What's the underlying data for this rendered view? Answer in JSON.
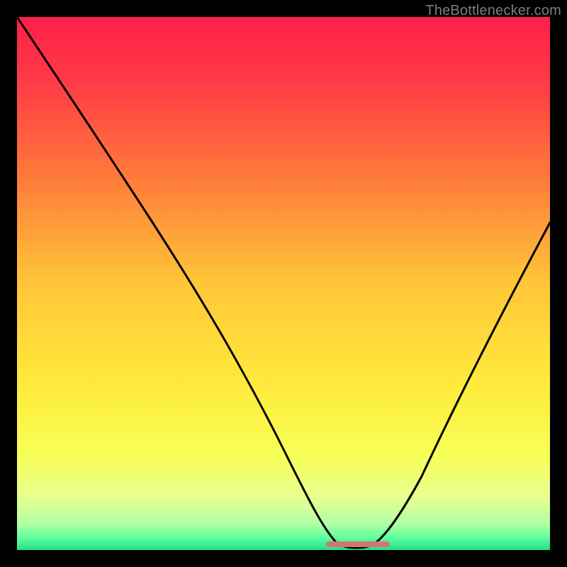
{
  "watermark": {
    "text": "TheBottlenecker.com"
  },
  "chart_data": {
    "type": "line",
    "title": "",
    "xlabel": "",
    "ylabel": "",
    "xlim": [
      0,
      100
    ],
    "ylim": [
      0,
      100
    ],
    "grid": false,
    "legend": false,
    "background": {
      "type": "vertical-gradient",
      "stops": [
        {
          "pos": 0.0,
          "color": "#ff1f4a"
        },
        {
          "pos": 0.12,
          "color": "#ff3a46"
        },
        {
          "pos": 0.3,
          "color": "#ff7a3a"
        },
        {
          "pos": 0.5,
          "color": "#ffc638"
        },
        {
          "pos": 0.68,
          "color": "#ffe83a"
        },
        {
          "pos": 0.82,
          "color": "#f8ff55"
        },
        {
          "pos": 0.9,
          "color": "#e7ff8f"
        },
        {
          "pos": 0.95,
          "color": "#b3ffa3"
        },
        {
          "pos": 0.975,
          "color": "#66ff9e"
        },
        {
          "pos": 1.0,
          "color": "#21e08f"
        }
      ]
    },
    "series": [
      {
        "name": "bottleneck-curve",
        "color": "#000000",
        "x": [
          0,
          5,
          10,
          15,
          20,
          25,
          30,
          35,
          40,
          45,
          50,
          55,
          58,
          61,
          63,
          67,
          70,
          72,
          75,
          80,
          85,
          90,
          95,
          100
        ],
        "y": [
          100,
          92,
          84,
          76,
          68,
          60,
          52,
          43,
          35,
          27,
          19,
          11,
          6,
          3,
          1,
          1,
          2,
          5,
          10,
          19,
          29,
          40,
          52,
          64
        ]
      }
    ],
    "annotations": [
      {
        "name": "optimal-range-bar",
        "type": "segment",
        "color": "#d1766f",
        "y": 0.5,
        "x_start": 58,
        "x_end": 70
      }
    ]
  }
}
